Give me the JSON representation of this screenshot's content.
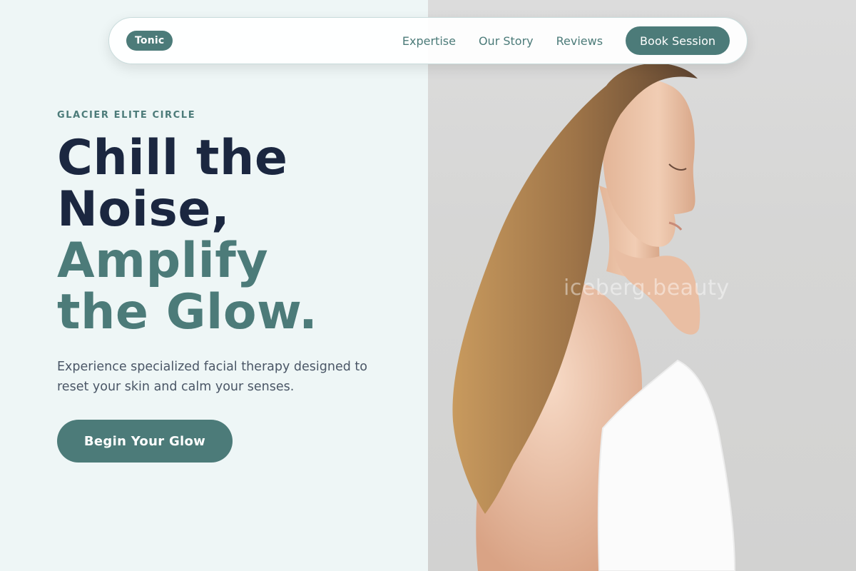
{
  "nav": {
    "brand": "Tonic",
    "links": [
      "Expertise",
      "Our Story",
      "Reviews"
    ],
    "cta": "Book Session"
  },
  "hero": {
    "eyebrow": "GLACIER ELITE CIRCLE",
    "headline_line1": "Chill the",
    "headline_line2": "Noise,",
    "headline_line3": "Amplify",
    "headline_line4": "the Glow.",
    "subtext": "Experience specialized facial therapy designed to reset your skin and calm your senses.",
    "cta": "Begin Your Glow"
  },
  "image": {
    "watermark": "iceberg.beauty"
  },
  "colors": {
    "accent": "#4c7b79",
    "heading_dark": "#1b2740",
    "panel_bg": "#eef6f6"
  }
}
